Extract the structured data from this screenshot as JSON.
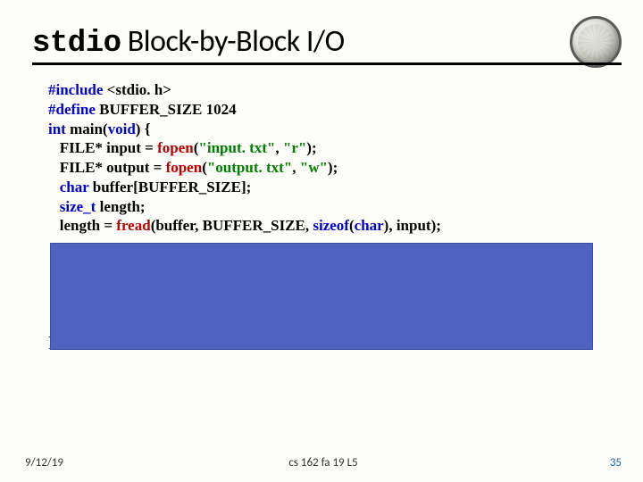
{
  "title": {
    "keyword": "stdio",
    "rest": " Block-by-Block I/O"
  },
  "code": {
    "l1_kw1": "#include",
    "l1_rest": " <stdio. h>",
    "l2_kw1": "#define",
    "l2_rest": " BUFFER_SIZE 1024",
    "l3_kw1": "int",
    "l3_mid": " main(",
    "l3_kw2": "void",
    "l3_end": ") {",
    "l4_pre": "   FILE* input = ",
    "l4_fn": "fopen",
    "l4_paren": "(",
    "l4_s1": "\"input. txt\"",
    "l4_c1": ", ",
    "l4_s2": "\"r\"",
    "l4_end": ");",
    "l5_pre": "   FILE* output = ",
    "l5_fn": "fopen",
    "l5_paren": "(",
    "l5_s1": "\"output. txt\"",
    "l5_c1": ", ",
    "l5_s2": "\"w\"",
    "l5_end": ");",
    "l6_kw": "char",
    "l6_rest": " buffer[BUFFER_SIZE];",
    "l7_kw": "size_t",
    "l7_rest": " length;",
    "l8_pre": "   length = ",
    "l8_fn": "fread",
    "l8_mid1": "(buffer, BUFFER_SIZE, ",
    "l8_kw": "sizeof",
    "l8_mid2": "(",
    "l8_kw2": "char",
    "l8_end": "), input);",
    "close": "}"
  },
  "footer": {
    "left": "9/12/19",
    "center": "cs 162 fa 19 L5",
    "right": "35"
  }
}
